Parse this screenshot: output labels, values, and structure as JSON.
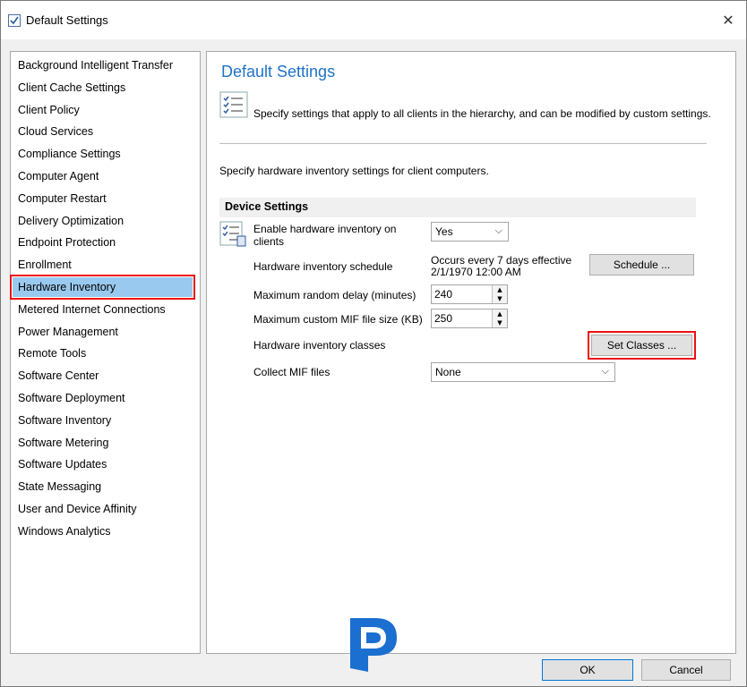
{
  "window": {
    "title": "Default Settings"
  },
  "sidebar": {
    "items": [
      {
        "label": "Background Intelligent Transfer"
      },
      {
        "label": "Client Cache Settings"
      },
      {
        "label": "Client Policy"
      },
      {
        "label": "Cloud Services"
      },
      {
        "label": "Compliance Settings"
      },
      {
        "label": "Computer Agent"
      },
      {
        "label": "Computer Restart"
      },
      {
        "label": "Delivery Optimization"
      },
      {
        "label": "Endpoint Protection"
      },
      {
        "label": "Enrollment"
      },
      {
        "label": "Hardware Inventory",
        "selected": true
      },
      {
        "label": "Metered Internet Connections"
      },
      {
        "label": "Power Management"
      },
      {
        "label": "Remote Tools"
      },
      {
        "label": "Software Center"
      },
      {
        "label": "Software Deployment"
      },
      {
        "label": "Software Inventory"
      },
      {
        "label": "Software Metering"
      },
      {
        "label": "Software Updates"
      },
      {
        "label": "State Messaging"
      },
      {
        "label": "User and Device Affinity"
      },
      {
        "label": "Windows Analytics"
      }
    ]
  },
  "main": {
    "heading": "Default Settings",
    "intro": "Specify settings that apply to all clients in the hierarchy, and can be modified by custom settings.",
    "description": "Specify hardware inventory settings for client computers.",
    "group_title": "Device Settings",
    "enable_label": "Enable hardware inventory on clients",
    "enable_value": "Yes",
    "schedule_label": "Hardware inventory schedule",
    "schedule_text_1": "Occurs every 7 days effective",
    "schedule_text_2": "2/1/1970 12:00 AM",
    "schedule_button": "Schedule ...",
    "delay_label": "Maximum random delay (minutes)",
    "delay_value": "240",
    "mif_size_label": "Maximum custom MIF file size (KB)",
    "mif_size_value": "250",
    "classes_label": "Hardware inventory classes",
    "classes_button": "Set Classes ...",
    "collect_mif_label": "Collect MIF files",
    "collect_mif_value": "None"
  },
  "footer": {
    "ok_label": "OK",
    "cancel_label": "Cancel"
  },
  "colors": {
    "accent": "#1e73c6",
    "selection": "#99c9ef",
    "highlight": "#ee1111",
    "logo_blue": "#1a6fd0"
  }
}
